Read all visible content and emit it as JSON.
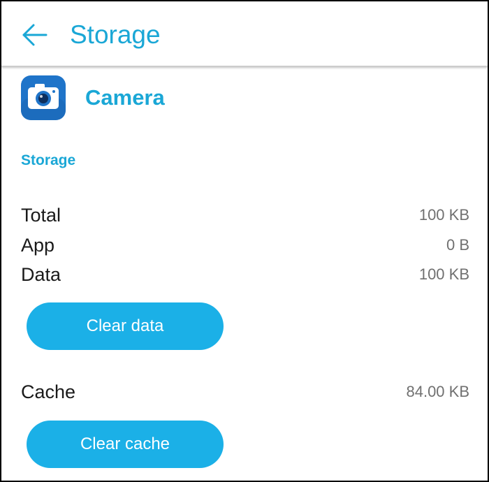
{
  "header": {
    "back_icon": "arrow-left-icon",
    "title": "Storage"
  },
  "app": {
    "icon": "camera-icon",
    "name": "Camera"
  },
  "storage": {
    "section_title": "Storage",
    "rows": [
      {
        "label": "Total",
        "value": "100 KB"
      },
      {
        "label": "App",
        "value": "0 B"
      },
      {
        "label": "Data",
        "value": "100 KB"
      }
    ],
    "clear_data_label": "Clear data"
  },
  "cache": {
    "label": "Cache",
    "value": "84.00 KB",
    "clear_cache_label": "Clear cache"
  },
  "colors": {
    "accent": "#1aa7d6",
    "button": "#1bb0e7",
    "icon_bg": "#1f74c9"
  }
}
